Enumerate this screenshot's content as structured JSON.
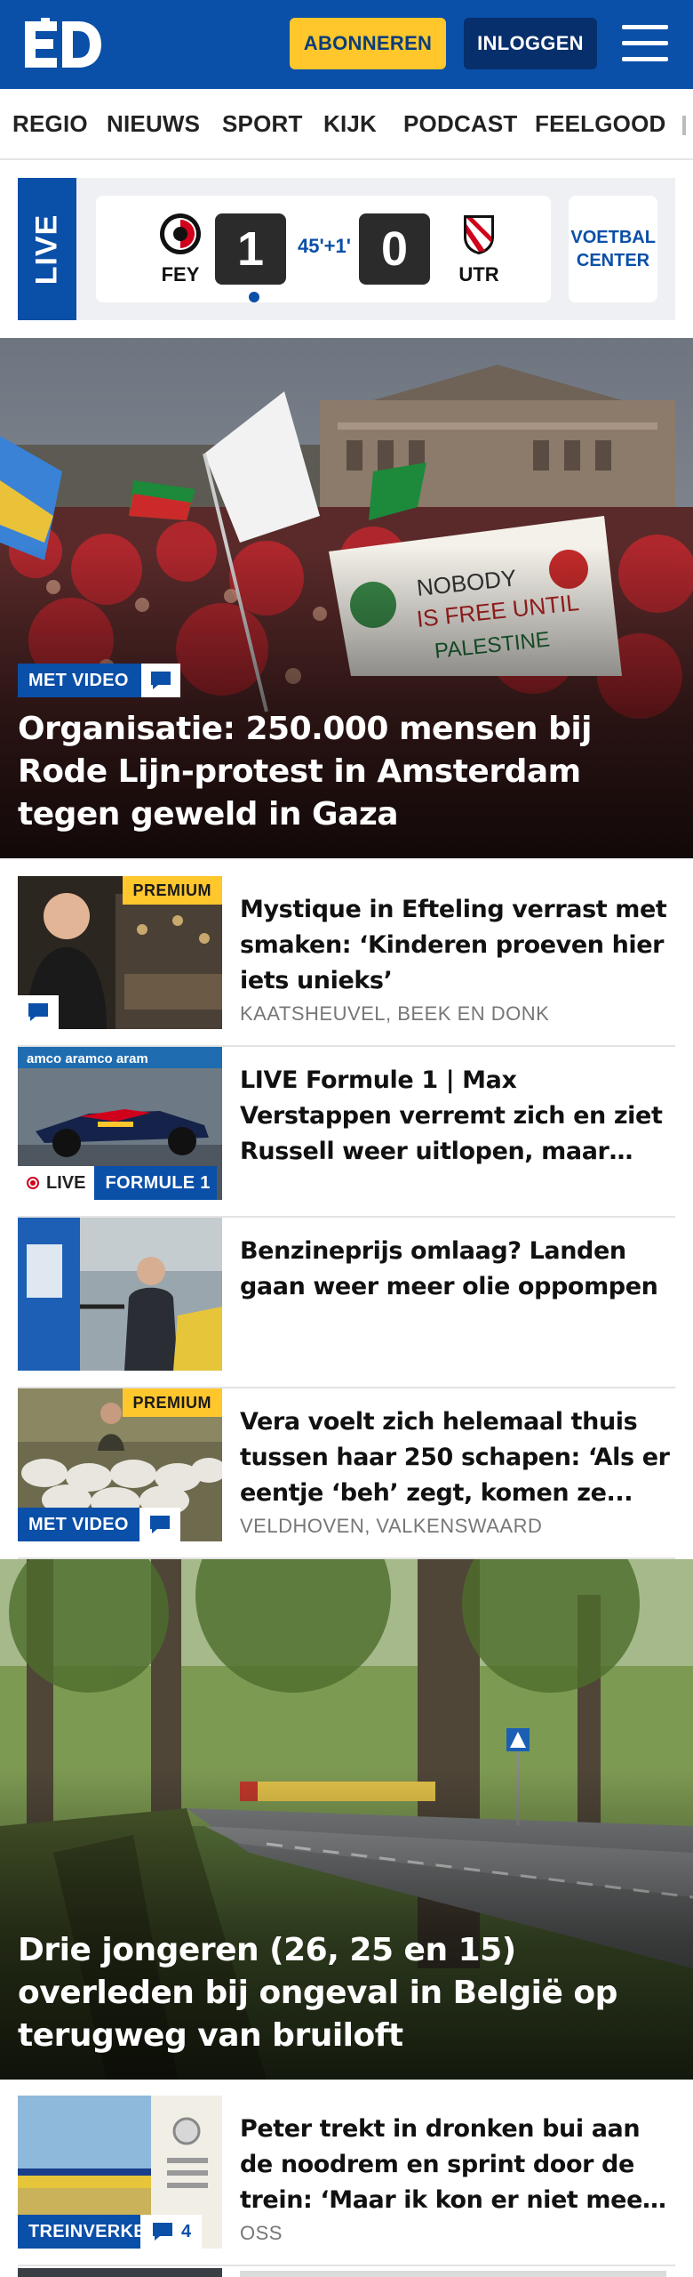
{
  "header": {
    "logo_text": "ED",
    "subscribe_label": "ABONNEREN",
    "login_label": "INLOGGEN",
    "menu_icon": "hamburger-menu-icon",
    "brand_color": "#0a4fa8",
    "accent_color": "#ffc72c"
  },
  "nav": {
    "items": [
      "REGIO",
      "NIEUWS",
      "SPORT",
      "KIJK",
      "PODCAST",
      "FEELGOOD"
    ]
  },
  "live": {
    "tag": "LIVE",
    "home_code": "FEY",
    "away_code": "UTR",
    "home_score": "1",
    "away_score": "0",
    "time": "45'+1'",
    "center_label": "VOETBAL CENTER"
  },
  "hero1": {
    "badge": "MET VIDEO",
    "title": "Organisatie: 250.000 mensen bij Rode Lijn-protest in Amsterdam tegen geweld in Gaza",
    "banner_text": "NOBODY IS FREE UNTIL PALESTINE IS FREE"
  },
  "articles": [
    {
      "title": "Mystique in Efteling verrast met smaken: ‘Kinderen proeven hier iets unieks’",
      "location": "KAATSHEUVEL, BEEK EN DONK",
      "premium": "PREMIUM"
    },
    {
      "title": "LIVE Formule 1 | Max Verstappen verremt zich en ziet Russell weer uitlopen, maar houdt Norris...",
      "live_label": "LIVE",
      "section": "FORMULE 1"
    },
    {
      "title": "Benzineprijs omlaag? Landen gaan weer meer olie oppompen"
    },
    {
      "title": "Vera voelt zich helemaal thuis tussen haar 250 schapen: ‘Als er eentje ‘beh’ zegt, komen ze...",
      "location": "VELDHOVEN, VALKENSWAARD",
      "premium": "PREMIUM",
      "badge": "MET VIDEO"
    }
  ],
  "hero2": {
    "title": "Drie jongeren (26, 25 en 15) overleden bij ongeval in België op terugweg van bruiloft"
  },
  "article5": {
    "title": "Peter trekt in dronken bui aan de noodrem en sprint door de trein: ‘Maar ik kon er niet meer uit’",
    "location": "OSS",
    "section": "TREINVERKEER",
    "comment_count": "4"
  }
}
